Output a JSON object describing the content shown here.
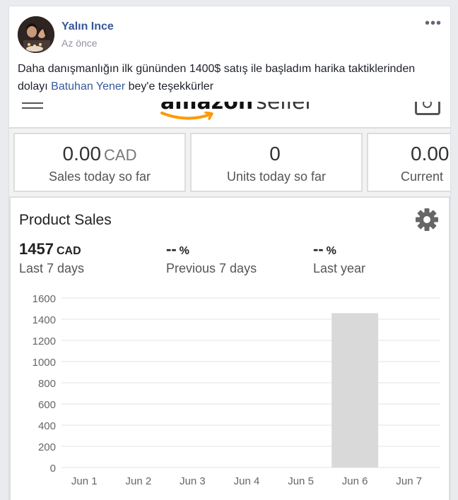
{
  "post": {
    "author": "Yalın Ince",
    "time": "Az önce",
    "text_before": "Daha danışmanlığın ilk gününden 1400$ satış ile başladım harika taktiklerinden dolayı ",
    "mention": "Batuhan Yener",
    "text_after": " bey'e teşekkürler",
    "more_icon": "more-options-icon"
  },
  "seller": {
    "brand_bold": "amazon",
    "brand_light": "seller",
    "metrics": [
      {
        "value": "0.00",
        "unit": "CAD",
        "label": "Sales today so far"
      },
      {
        "value": "0",
        "unit": "",
        "label": "Units today so far"
      },
      {
        "value": "0.00",
        "unit": "",
        "label": "Current"
      }
    ],
    "product_sales": {
      "title": "Product Sales",
      "stats": [
        {
          "value": "1457",
          "unit": "CAD",
          "label": "Last 7 days"
        },
        {
          "value": "--",
          "unit": "%",
          "label": "Previous 7 days"
        },
        {
          "value": "--",
          "unit": "%",
          "label": "Last year"
        }
      ]
    }
  },
  "colors": {
    "bar": "#d9d9d9",
    "link": "#365899",
    "grid": "#e3e3e3"
  },
  "chart_data": {
    "type": "bar",
    "categories": [
      "Jun 1",
      "Jun 2",
      "Jun 3",
      "Jun 4",
      "Jun 5",
      "Jun 6",
      "Jun 7"
    ],
    "values": [
      0,
      0,
      0,
      0,
      0,
      1457,
      0
    ],
    "yticks": [
      "1600",
      "1400",
      "1200",
      "1000",
      "800",
      "600",
      "400",
      "200",
      "0"
    ],
    "ylim": [
      0,
      1600
    ],
    "grid": true
  }
}
